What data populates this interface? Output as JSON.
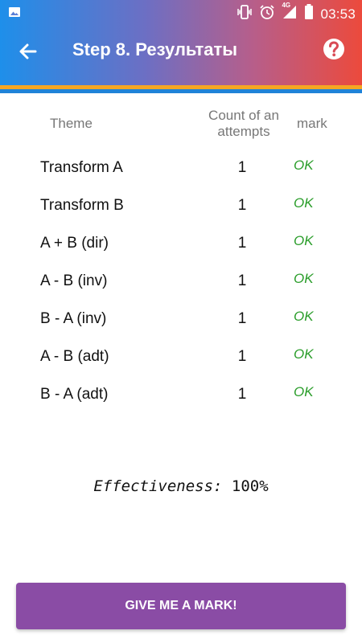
{
  "status_bar": {
    "time": "03:53",
    "network": "4G",
    "icons": [
      "image-icon",
      "vibrate-icon",
      "alarm-icon",
      "signal-icon",
      "battery-icon"
    ]
  },
  "toolbar": {
    "title": "Step 8. Результаты",
    "back_icon": "arrow-left-icon",
    "help_icon": "help-circle-icon"
  },
  "table": {
    "headers": {
      "theme": "Theme",
      "count": "Count of an attempts",
      "mark": "mark"
    },
    "rows": [
      {
        "theme": "Transform A",
        "count": "1",
        "mark": "OK"
      },
      {
        "theme": "Transform B",
        "count": "1",
        "mark": "OK"
      },
      {
        "theme": "A + B (dir)",
        "count": "1",
        "mark": "OK"
      },
      {
        "theme": "A - B (inv)",
        "count": "1",
        "mark": "OK"
      },
      {
        "theme": "B - A (inv)",
        "count": "1",
        "mark": "OK"
      },
      {
        "theme": "A - B (adt)",
        "count": "1",
        "mark": "OK"
      },
      {
        "theme": "B - A (adt)",
        "count": "1",
        "mark": "OK"
      }
    ]
  },
  "summary": {
    "label": "Effectiveness:",
    "value": "100%"
  },
  "action": {
    "label": "GIVE ME A MARK!"
  },
  "colors": {
    "gradient_start": "#1e8fea",
    "gradient_end": "#ec4a3c",
    "stripe_orange": "#f5a623",
    "stripe_blue": "#1f83d8",
    "ok_green": "#2a9d2a",
    "button_purple": "#8a4ca5"
  }
}
